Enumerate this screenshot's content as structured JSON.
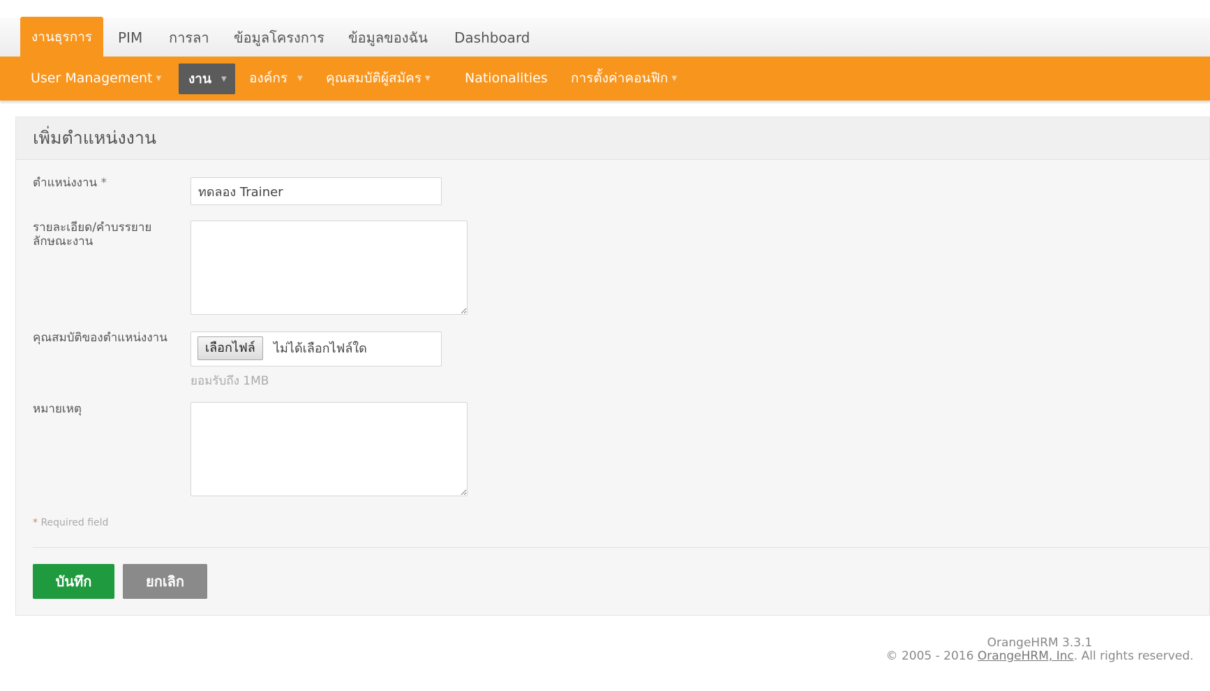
{
  "top_nav": {
    "tabs": [
      "งานธุรการ",
      "PIM",
      "การลา",
      "ข้อมูลโครงการ",
      "ข้อมูลของฉัน",
      "Dashboard"
    ],
    "active": "งานธุรการ"
  },
  "sub_nav": {
    "items": [
      "User Management",
      "งาน",
      "องค์กร",
      "คุณสมบัติผู้สมัคร",
      "Nationalities",
      "การตั้งค่าคอนฟิก"
    ],
    "active": "งาน"
  },
  "form": {
    "title": "เพิ่มตำแหน่งงาน",
    "job_title_label": "ตำแหน่งงาน",
    "required_star": "*",
    "job_title_value": "ทดลอง Trainer",
    "description_label_line1": "รายละเอียด/คำบรรยาย",
    "description_label_line2": "ลักษณะงาน",
    "spec_label": "คุณสมบัติของตำแหน่งงาน",
    "choose_file_label": "เลือกไฟล์",
    "no_file_text": "ไม่ได้เลือกไฟล์ใด",
    "file_hint": "ยอมรับถึง 1MB",
    "note_label": "หมายเหตุ",
    "required_note": "Required field",
    "save_label": "บันทึก",
    "cancel_label": "ยกเลิก"
  },
  "footer": {
    "version": "OrangeHRM 3.3.1",
    "copyright_prefix": "© 2005 - 2016",
    "company_link": "OrangeHRM, Inc",
    "rights": ". All rights reserved."
  },
  "colors": {
    "accent": "#f8951d",
    "active_sub": "#5b5b5b",
    "save": "#1f9a3e",
    "cancel": "#8a8a8a"
  }
}
